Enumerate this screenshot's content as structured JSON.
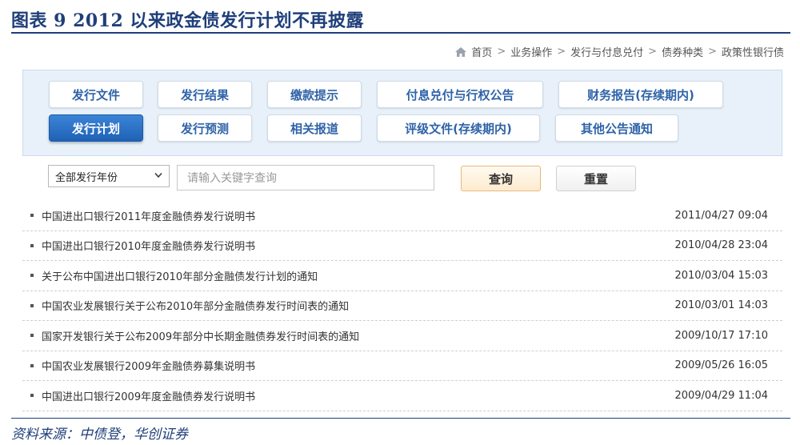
{
  "figure": {
    "title": "图表 9  2012 以来政金债发行计划不再披露",
    "source": "资料来源：中债登，华创证券"
  },
  "breadcrumb": {
    "items": [
      "首页",
      "业务操作",
      "发行与付息兑付",
      "债券种类",
      "政策性银行债"
    ],
    "separator": ">"
  },
  "tabs": [
    {
      "label": "发行文件",
      "active": false
    },
    {
      "label": "发行结果",
      "active": false
    },
    {
      "label": "缴款提示",
      "active": false
    },
    {
      "label": "付息兑付与行权公告",
      "active": false
    },
    {
      "label": "财务报告(存续期内)",
      "active": false
    },
    {
      "label": "发行计划",
      "active": true
    },
    {
      "label": "发行预测",
      "active": false
    },
    {
      "label": "相关报道",
      "active": false
    },
    {
      "label": "评级文件(存续期内)",
      "active": false
    },
    {
      "label": "其他公告通知",
      "active": false
    }
  ],
  "filter": {
    "year_select": "全部发行年份",
    "search_placeholder": "请输入关键字查询",
    "query_label": "查询",
    "reset_label": "重置"
  },
  "items": [
    {
      "title": "中国进出口银行2011年度金融债券发行说明书",
      "date": "2011/04/27 09:04"
    },
    {
      "title": "中国进出口银行2010年度金融债券发行说明书",
      "date": "2010/04/28 23:04"
    },
    {
      "title": "关于公布中国进出口银行2010年部分金融债发行计划的通知",
      "date": "2010/03/04 15:03"
    },
    {
      "title": "中国农业发展银行关于公布2010年部分金融债券发行时间表的通知",
      "date": "2010/03/01 14:03"
    },
    {
      "title": "国家开发银行关于公布2009年部分中长期金融债券发行时间表的通知",
      "date": "2009/10/17 17:10"
    },
    {
      "title": "中国农业发展银行2009年金融债券募集说明书",
      "date": "2009/05/26 16:05"
    },
    {
      "title": "中国进出口银行2009年度金融债券发行说明书",
      "date": "2009/04/29 11:04"
    }
  ],
  "colors": {
    "title_blue": "#1f3f7a",
    "tab_text": "#2f63a8",
    "tab_active": "#2a72c8",
    "panel_bg": "#e8f1fa",
    "query_button": "#fdebcf"
  }
}
